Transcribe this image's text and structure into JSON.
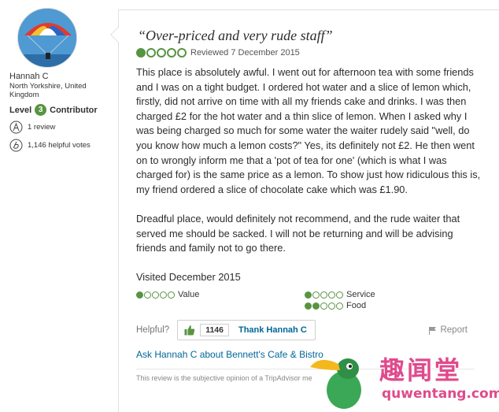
{
  "member": {
    "name": "Hannah C",
    "location": "North Yorkshire, United Kingdom",
    "level_prefix": "Level",
    "level_number": "3",
    "level_suffix": "Contributor",
    "reviews": "1 review",
    "helpful_votes": "1,146 helpful votes"
  },
  "review": {
    "title": "“Over-priced and very rude staff”",
    "rating": 1,
    "reviewed_date": "Reviewed 7 December 2015",
    "paragraphs": [
      "This place is absolutely awful. I went out for afternoon tea with some friends and I was on a tight budget. I ordered hot water and a slice of lemon which, firstly, did not arrive on time with all my friends cake and drinks. I was then charged £2 for the hot water and a thin slice of lemon. When I asked why I was being charged so much for some water the waiter rudely said \"well, do you know how much a lemon costs?\" Yes, its definitely not £2. He then went on to wrongly inform me that a 'pot of tea for one' (which is what I was charged for) is the same price as a lemon. To show just how ridiculous this is, my friend ordered a slice of chocolate cake which was £1.90.",
      "Dreadful place, would definitely not recommend, and the rude waiter that served me should be sacked. I will not be returning and will be advising friends and family not to go there."
    ],
    "visited": "Visited December 2015",
    "subratings": [
      {
        "label": "Value",
        "rating": 1
      },
      {
        "label": "Service",
        "rating": 1
      },
      {
        "label": "Food",
        "rating": 2
      }
    ]
  },
  "actions": {
    "helpful_label": "Helpful?",
    "thank_count": "1146",
    "thank_label": "Thank Hannah C",
    "report_label": "Report",
    "ask_link": "Ask Hannah C about Bennett's Cafe & Bistro",
    "disclaimer": "This review is the subjective opinion of a TripAdvisor me"
  },
  "watermark": {
    "text": "趣闻堂",
    "url": "quwentang.com"
  },
  "colors": {
    "bubble_green": "#589442",
    "link_blue": "#006699",
    "watermark_pink": "#e04a8c"
  }
}
